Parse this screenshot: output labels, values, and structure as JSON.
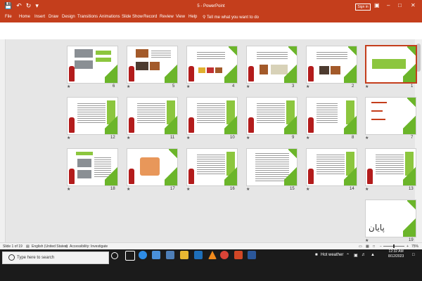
{
  "window": {
    "title": "5 - PowerPoint",
    "sign_in": "Sign in"
  },
  "ribbon": {
    "tabs": [
      "File",
      "Home",
      "Insert",
      "Draw",
      "Design",
      "Transitions",
      "Animations",
      "Slide Show",
      "Record",
      "Review",
      "View",
      "Help"
    ],
    "tell_me": "Tell me what you want to do"
  },
  "slides": {
    "rows": [
      [
        "6",
        "5",
        "4",
        "3",
        "2",
        "1"
      ],
      [
        "12",
        "11",
        "10",
        "9",
        "8",
        "7"
      ],
      [
        "18",
        "17",
        "16",
        "15",
        "14",
        "13"
      ],
      [
        "19"
      ]
    ],
    "selected": "1",
    "last_slide_title": "پایان"
  },
  "status": {
    "slide_info": "Slide 1 of 19",
    "language": "English (United States)",
    "accessibility": "Accessibility: Investigate",
    "zoom": "75%"
  },
  "taskbar": {
    "search_placeholder": "Type here to search",
    "weather": "Hot weather",
    "time": "12:32 AM",
    "date": "8/12/2023"
  },
  "colors": {
    "accent": "#c43e1c",
    "slide_green": "#8cc63e",
    "hydrant_red": "#b31c1c"
  }
}
